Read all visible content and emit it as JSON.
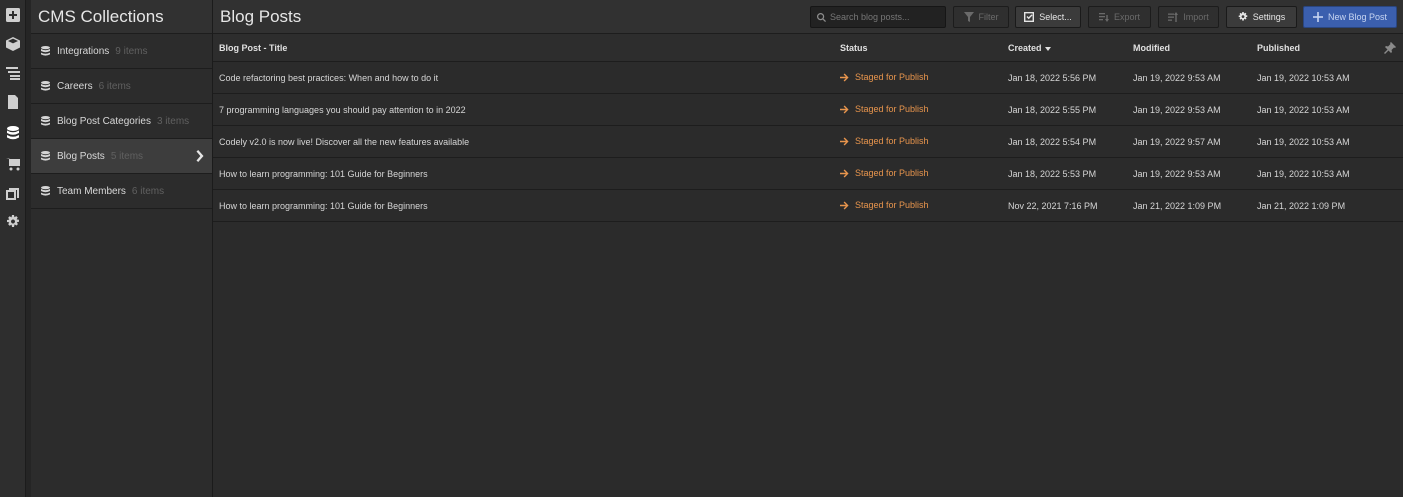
{
  "rail": {
    "icons": [
      "add-icon",
      "box-icon",
      "navigator-icon",
      "pages-icon",
      "cms-database-icon",
      "ecommerce-cart-icon",
      "assets-icon",
      "settings-gear-icon"
    ],
    "active": "cms-database-icon"
  },
  "collections": {
    "title": "CMS Collections",
    "items": [
      {
        "name": "Integrations",
        "count": "9 items"
      },
      {
        "name": "Careers",
        "count": "6 items"
      },
      {
        "name": "Blog Post Categories",
        "count": "3 items"
      },
      {
        "name": "Blog Posts",
        "count": "5 items",
        "selected": true
      },
      {
        "name": "Team Members",
        "count": "6 items"
      }
    ]
  },
  "header": {
    "title": "Blog Posts",
    "search_placeholder": "Search blog posts...",
    "filter_label": "Filter",
    "select_label": "Select...",
    "export_label": "Export",
    "import_label": "Import",
    "settings_label": "Settings",
    "new_label": "New Blog Post"
  },
  "table": {
    "columns": {
      "title": "Blog Post - Title",
      "status": "Status",
      "created": "Created",
      "modified": "Modified",
      "published": "Published"
    },
    "rows": [
      {
        "title": "Code refactoring best practices: When and how to do it",
        "status": "Staged for Publish",
        "created": "Jan 18, 2022 5:56 PM",
        "modified": "Jan 19, 2022 9:53 AM",
        "published": "Jan 19, 2022 10:53 AM"
      },
      {
        "title": "7 programming languages you should pay attention to in 2022",
        "status": "Staged for Publish",
        "created": "Jan 18, 2022 5:55 PM",
        "modified": "Jan 19, 2022 9:53 AM",
        "published": "Jan 19, 2022 10:53 AM"
      },
      {
        "title": "Codely v2.0 is now live! Discover all the new features available",
        "status": "Staged for Publish",
        "created": "Jan 18, 2022 5:54 PM",
        "modified": "Jan 19, 2022 9:57 AM",
        "published": "Jan 19, 2022 10:53 AM"
      },
      {
        "title": "How to learn programming: 101 Guide for Beginners",
        "status": "Staged for Publish",
        "created": "Jan 18, 2022 5:53 PM",
        "modified": "Jan 19, 2022 9:53 AM",
        "published": "Jan 19, 2022 10:53 AM"
      },
      {
        "title": "How to learn programming: 101 Guide for Beginners",
        "status": "Staged for Publish",
        "created": "Nov 22, 2021 7:16 PM",
        "modified": "Jan 21, 2022 1:09 PM",
        "published": "Jan 21, 2022 1:09 PM"
      }
    ]
  },
  "colors": {
    "status_staged": "#e8954d",
    "primary_button": "#3b5fae",
    "background": "#2b2b2b"
  }
}
